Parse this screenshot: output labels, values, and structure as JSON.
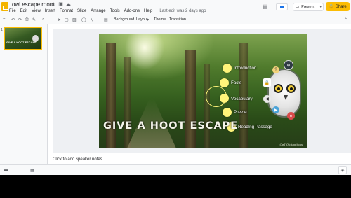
{
  "document": {
    "title": "owl escape room",
    "title_icons": [
      "star-icon",
      "move-icon",
      "cloud-icon"
    ]
  },
  "menu": {
    "items": [
      "File",
      "Edit",
      "View",
      "Insert",
      "Format",
      "Slide",
      "Arrange",
      "Tools",
      "Add-ons",
      "Help"
    ],
    "last_edit": "Last edit was 2 days ago"
  },
  "header": {
    "present_label": "Present",
    "share_label": "Share"
  },
  "toolbar": {
    "background_label": "Background",
    "layout_label": "Layout",
    "theme_label": "Theme",
    "transition_label": "Transition"
  },
  "filmstrip": {
    "slides": [
      {
        "number": "1",
        "thumb_title": "GIVE A HOOT ESCAPE"
      }
    ]
  },
  "slide": {
    "title": "GIVE A HOOT ESCAPE",
    "menu_items": [
      "Introduction",
      "Facts",
      "Vocabulary",
      "Puzzle",
      "Reading Passage"
    ],
    "signature": "Owl Obligations",
    "colors": {
      "accent_dot": "#fff47a",
      "share_button": "#fbbc04"
    }
  },
  "notes": {
    "placeholder": "Click to add speaker notes"
  }
}
